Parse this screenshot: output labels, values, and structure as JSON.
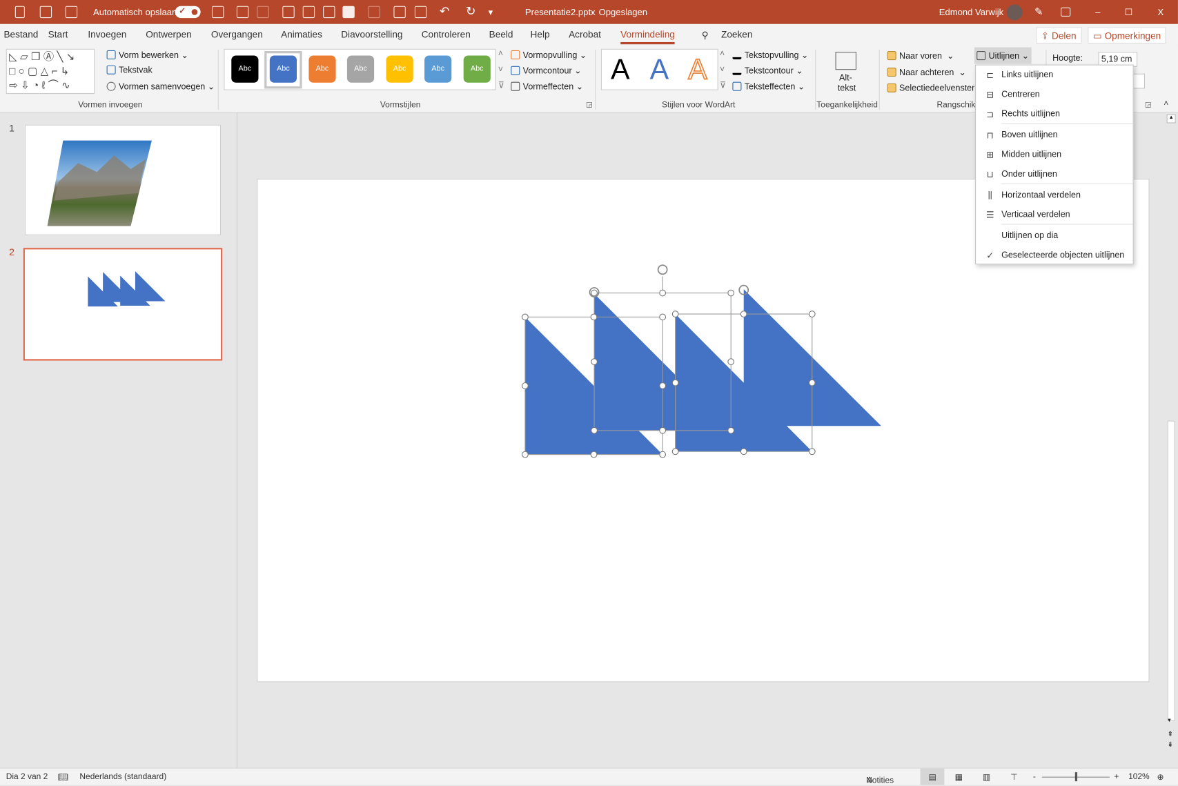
{
  "titlebar": {
    "autosave_label": "Automatisch opslaan",
    "autosave_state": "on",
    "document": "Presentatie2.pptx",
    "separator": "-",
    "save_status": "Opgeslagen",
    "user": "Edmond Varwijk",
    "minimize": "–",
    "maximize": "☐",
    "close": "X"
  },
  "tabs": [
    "Bestand",
    "Start",
    "Invoegen",
    "Ontwerpen",
    "Overgangen",
    "Animaties",
    "Diavoorstelling",
    "Controleren",
    "Beeld",
    "Help",
    "Acrobat",
    "Vormindeling"
  ],
  "active_tab": "Vormindeling",
  "search": "Zoeken",
  "share": "Delen",
  "comments": "Opmerkingen",
  "ribbon": {
    "insert_shapes": {
      "label": "Vormen invoegen",
      "edit_shape": "Vorm bewerken",
      "textbox": "Tekstvak",
      "merge_shapes": "Vormen samenvoegen"
    },
    "shape_styles": {
      "label": "Vormstijlen",
      "swatch_text": "Abc",
      "swatches": [
        "#000000",
        "#4472c4",
        "#ed7d31",
        "#a5a5a5",
        "#ffc000",
        "#5b9bd5",
        "#70ad47"
      ],
      "selected_index": 1,
      "fill": "Vormopvulling",
      "outline": "Vormcontour",
      "effects": "Vormeffecten"
    },
    "wordart": {
      "label": "Stijlen voor WordArt",
      "letter": "A",
      "text_fill": "Tekstopvulling",
      "text_outline": "Tekstcontour",
      "text_effects": "Teksteffecten"
    },
    "accessibility": {
      "label": "Toegankelijkheid",
      "alt_text_1": "Alt-",
      "alt_text_2": "tekst"
    },
    "arrange": {
      "label": "Rangschik",
      "bring_forward": "Naar voren",
      "send_backward": "Naar achteren",
      "selection_pane": "Selectiedeelvenster",
      "align": "Uitlijnen"
    },
    "size": {
      "height_label": "Hoogte:",
      "height_value": "5,19 cm"
    }
  },
  "align_menu": [
    {
      "label": "Links uitlijnen",
      "icon": "align-left-icon",
      "glyph": "⊏"
    },
    {
      "label": "Centreren",
      "icon": "align-center-icon",
      "glyph": "⊟"
    },
    {
      "label": "Rechts uitlijnen",
      "icon": "align-right-icon",
      "glyph": "⊐"
    },
    {
      "label": "Boven uitlijnen",
      "icon": "align-top-icon",
      "glyph": "⊓"
    },
    {
      "label": "Midden uitlijnen",
      "icon": "align-middle-icon",
      "glyph": "⊞"
    },
    {
      "label": "Onder uitlijnen",
      "icon": "align-bottom-icon",
      "glyph": "⊔"
    },
    {
      "label": "Horizontaal verdelen",
      "icon": "distribute-horizontal-icon",
      "glyph": "⫼"
    },
    {
      "label": "Verticaal verdelen",
      "icon": "distribute-vertical-icon",
      "glyph": "☰"
    },
    {
      "label": "Uitlijnen op dia",
      "icon": "",
      "glyph": ""
    },
    {
      "label": "Geselecteerde objecten uitlijnen",
      "icon": "checkmark-icon",
      "glyph": "✓"
    }
  ],
  "slides": [
    {
      "number": "1"
    },
    {
      "number": "2",
      "selected": true
    }
  ],
  "status": {
    "slide": "Dia 2 van 2",
    "language": "Nederlands (standaard)",
    "notes": "Notities",
    "zoom": "102%"
  },
  "colors": {
    "accent": "#b7472a",
    "shape_fill": "#4472c4"
  }
}
